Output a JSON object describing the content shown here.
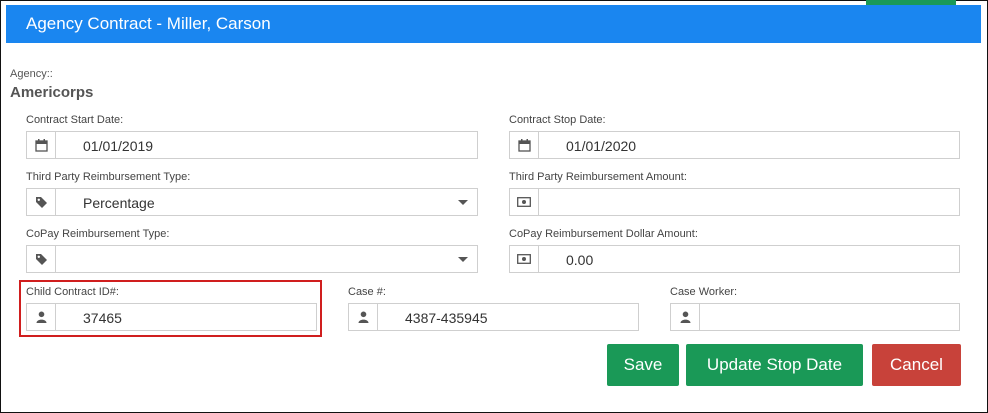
{
  "window": {
    "title": "Agency Contract - Miller, Carson"
  },
  "agency": {
    "label": "Agency::",
    "value": "Americorps"
  },
  "fields": {
    "contract_start_date": {
      "label": "Contract Start Date:",
      "value": "01/01/2019",
      "icon": "calendar-icon"
    },
    "contract_stop_date": {
      "label": "Contract Stop Date:",
      "value": "01/01/2020",
      "icon": "calendar-icon"
    },
    "third_party_type": {
      "label": "Third Party Reimbursement Type:",
      "value": "Percentage",
      "icon": "tag-icon"
    },
    "third_party_amount": {
      "label": "Third Party Reimbursement Amount:",
      "value": "",
      "icon": "money-icon"
    },
    "copay_type": {
      "label": "CoPay Reimbursement Type:",
      "value": "",
      "icon": "tag-icon"
    },
    "copay_amount": {
      "label": "CoPay Reimbursement Dollar Amount:",
      "value": "0.00",
      "icon": "money-icon"
    },
    "child_contract_id": {
      "label": "Child Contract ID#:",
      "value": "37465",
      "icon": "user-icon"
    },
    "case_number": {
      "label": "Case #:",
      "value": "4387-435945",
      "icon": "user-icon"
    },
    "case_worker": {
      "label": "Case Worker:",
      "value": "",
      "icon": "user-icon"
    }
  },
  "buttons": {
    "save": "Save",
    "update_stop_date": "Update Stop Date",
    "cancel": "Cancel"
  },
  "colors": {
    "header": "#1a86f0",
    "primary_button": "#1a9957",
    "cancel_button": "#c8423a",
    "highlight": "#d01e1e"
  }
}
